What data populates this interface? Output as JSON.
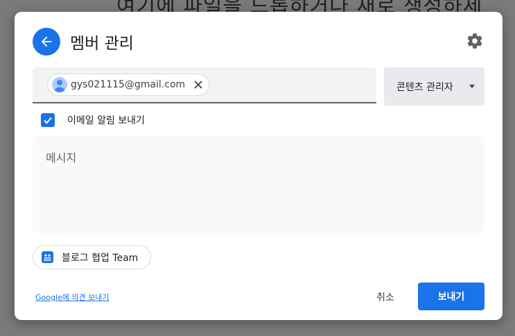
{
  "background": {
    "text": "여기에 파일을 드롭하거나 새로 생성하세"
  },
  "dialog": {
    "title": "멤버 관리",
    "recipient": {
      "email": "gys021115@gmail.com"
    },
    "role": {
      "selected": "콘텐츠 관리자"
    },
    "notify": {
      "label": "이메일 알림 보내기",
      "checked": true
    },
    "message": {
      "placeholder": "메시지"
    },
    "group": {
      "label": "블로그 협업 Team"
    },
    "footer": {
      "feedback_label": "Google에 의견 보내기",
      "cancel_label": "취소",
      "send_label": "보내기"
    }
  },
  "colors": {
    "accent": "#1a73e8",
    "overlay": "#7a7a7a"
  }
}
